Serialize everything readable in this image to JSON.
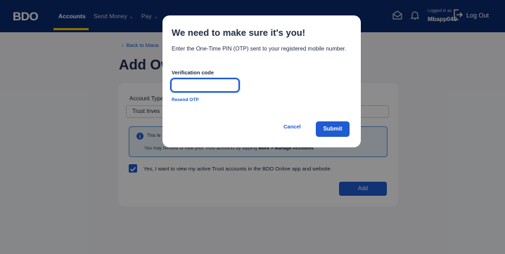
{
  "nav": {
    "logo": "BDO",
    "items": [
      {
        "label": "Accounts"
      },
      {
        "label": "Send Money"
      },
      {
        "label": "Pay"
      }
    ],
    "logged_in_label": "Logged in as",
    "username": "Mbapp040",
    "logout_label": "Log Out"
  },
  "page": {
    "back_label": "Back to Mana",
    "title": "Add Ow",
    "account_type_label": "Account Type",
    "account_type_value": "Trust Inves",
    "info_line1": "This fe",
    "info_line2_prefix": "You may remove or hide your Trust accounts by tapping",
    "info_line2_bold": "More > Manage Accounts",
    "checkbox_label": "Yes, I want to view my active Trust accounts in the BDO Online app and website.",
    "add_button": "Add"
  },
  "modal": {
    "title": "We need to make sure it's you!",
    "description": "Enter the One-Time PIN (OTP) sent to your registered mobile number.",
    "field_label": "Verification code",
    "otp_value": "",
    "resend_label": "Resend OTP",
    "cancel_label": "Cancel",
    "submit_label": "Submit"
  },
  "colors": {
    "nav_bg": "#0b2a6f",
    "accent": "#1f5bd1",
    "logo_yellow": "#ffcc00"
  },
  "icons": [
    "chevron-left-icon",
    "mail-icon",
    "bell-icon",
    "logout-icon",
    "info-icon",
    "checkmark-icon",
    "chevron-down-icon"
  ]
}
